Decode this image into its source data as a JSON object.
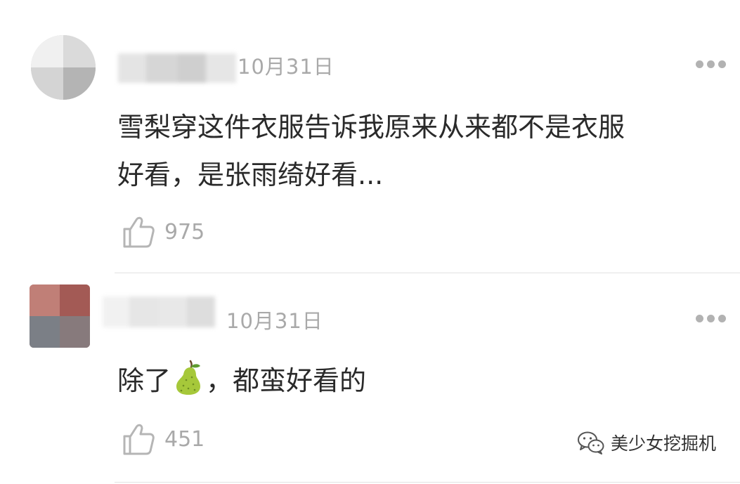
{
  "comments": [
    {
      "date": "10月31日",
      "text_lines": [
        "雪梨穿这件衣服告诉我原来从来都不是衣服",
        "好看，是张雨绮好看..."
      ],
      "likes": "975",
      "avatar_icon": "pixelated-avatar",
      "more_icon": "more-dots-icon",
      "like_icon": "thumbs-up-icon"
    },
    {
      "date": "10月31日",
      "text_before_emoji": "除了",
      "emoji_icon": "pear-emoji-icon",
      "text_after_emoji": "，都蛮好看的",
      "likes": "451",
      "avatar_icon": "pixelated-avatar",
      "more_icon": "more-dots-icon",
      "like_icon": "thumbs-up-icon"
    }
  ],
  "watermark": {
    "text": "美少女挖掘机",
    "icon": "wechat-icon"
  },
  "colors": {
    "meta_gray": "#a9a9a9",
    "text": "#2a2a2a",
    "divider": "#e3e3e3",
    "pear_green": "#a6c83a"
  }
}
